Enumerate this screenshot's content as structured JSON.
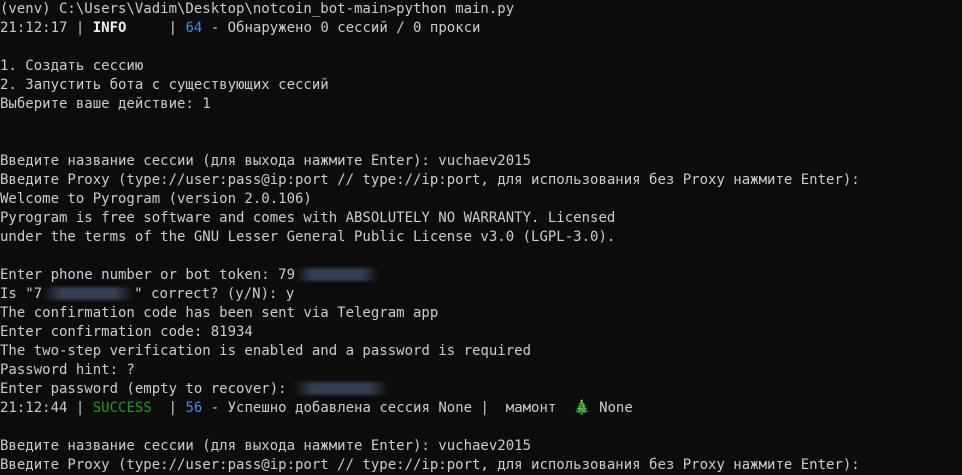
{
  "colors": {
    "background": "#0c0c0c",
    "text": "#cccccc",
    "number_blue": "#3b8eea",
    "success_green": "#13a10e"
  },
  "lines": {
    "l1": "(venv) C:\\Users\\Vadim\\Desktop\\notcoin_bot-main>python main.py",
    "l2_time": "21:12:17",
    "l2_sep1": " | ",
    "l2_level": "INFO",
    "l2_sep2": "     | ",
    "l2_num": "64",
    "l2_msg": " - Обнаружено 0 сессий / 0 прокси",
    "l4": "1. Создать сессию",
    "l5": "2. Запустить бота с существующих сессий",
    "l6": "Выберите ваше действие: 1",
    "l9": "Введите название сессии (для выхода нажмите Enter): vuchaev2015",
    "l10": "Введите Proxy (type://user:pass@ip:port // type://ip:port, для использования без Proxy нажмите Enter):",
    "l11": "Welcome to Pyrogram (version 2.0.106)",
    "l12": "Pyrogram is free software and comes with ABSOLUTELY NO WARRANTY. Licensed",
    "l13": "under the terms of the GNU Lesser General Public License v3.0 (LGPL-3.0).",
    "l15_prefix": "Enter phone number or bot token: 79",
    "l16_a": "Is \"7",
    "l16_b": "\" correct? (y/N): y",
    "l17": "The confirmation code has been sent via Telegram app",
    "l18": "Enter confirmation code: 81934",
    "l19": "The two-step verification is enabled and a password is required",
    "l20": "Password hint: ?",
    "l21": "Enter password (empty to recover):",
    "l22_time": "21:12:44",
    "l22_sep1": " | ",
    "l22_level": "SUCCESS",
    "l22_sep2": "  | ",
    "l22_num": "56",
    "l22_msg": " - Успешно добавлена сессия None |  мамонт  ",
    "l22_tail": " None",
    "l24": "Введите название сессии (для выхода нажмите Enter): vuchaev2015",
    "l25": "Введите Proxy (type://user:pass@ip:port // type://ip:port, для использования без Proxy нажмите Enter):"
  },
  "icons": {
    "tree": "christmas-tree-icon"
  }
}
